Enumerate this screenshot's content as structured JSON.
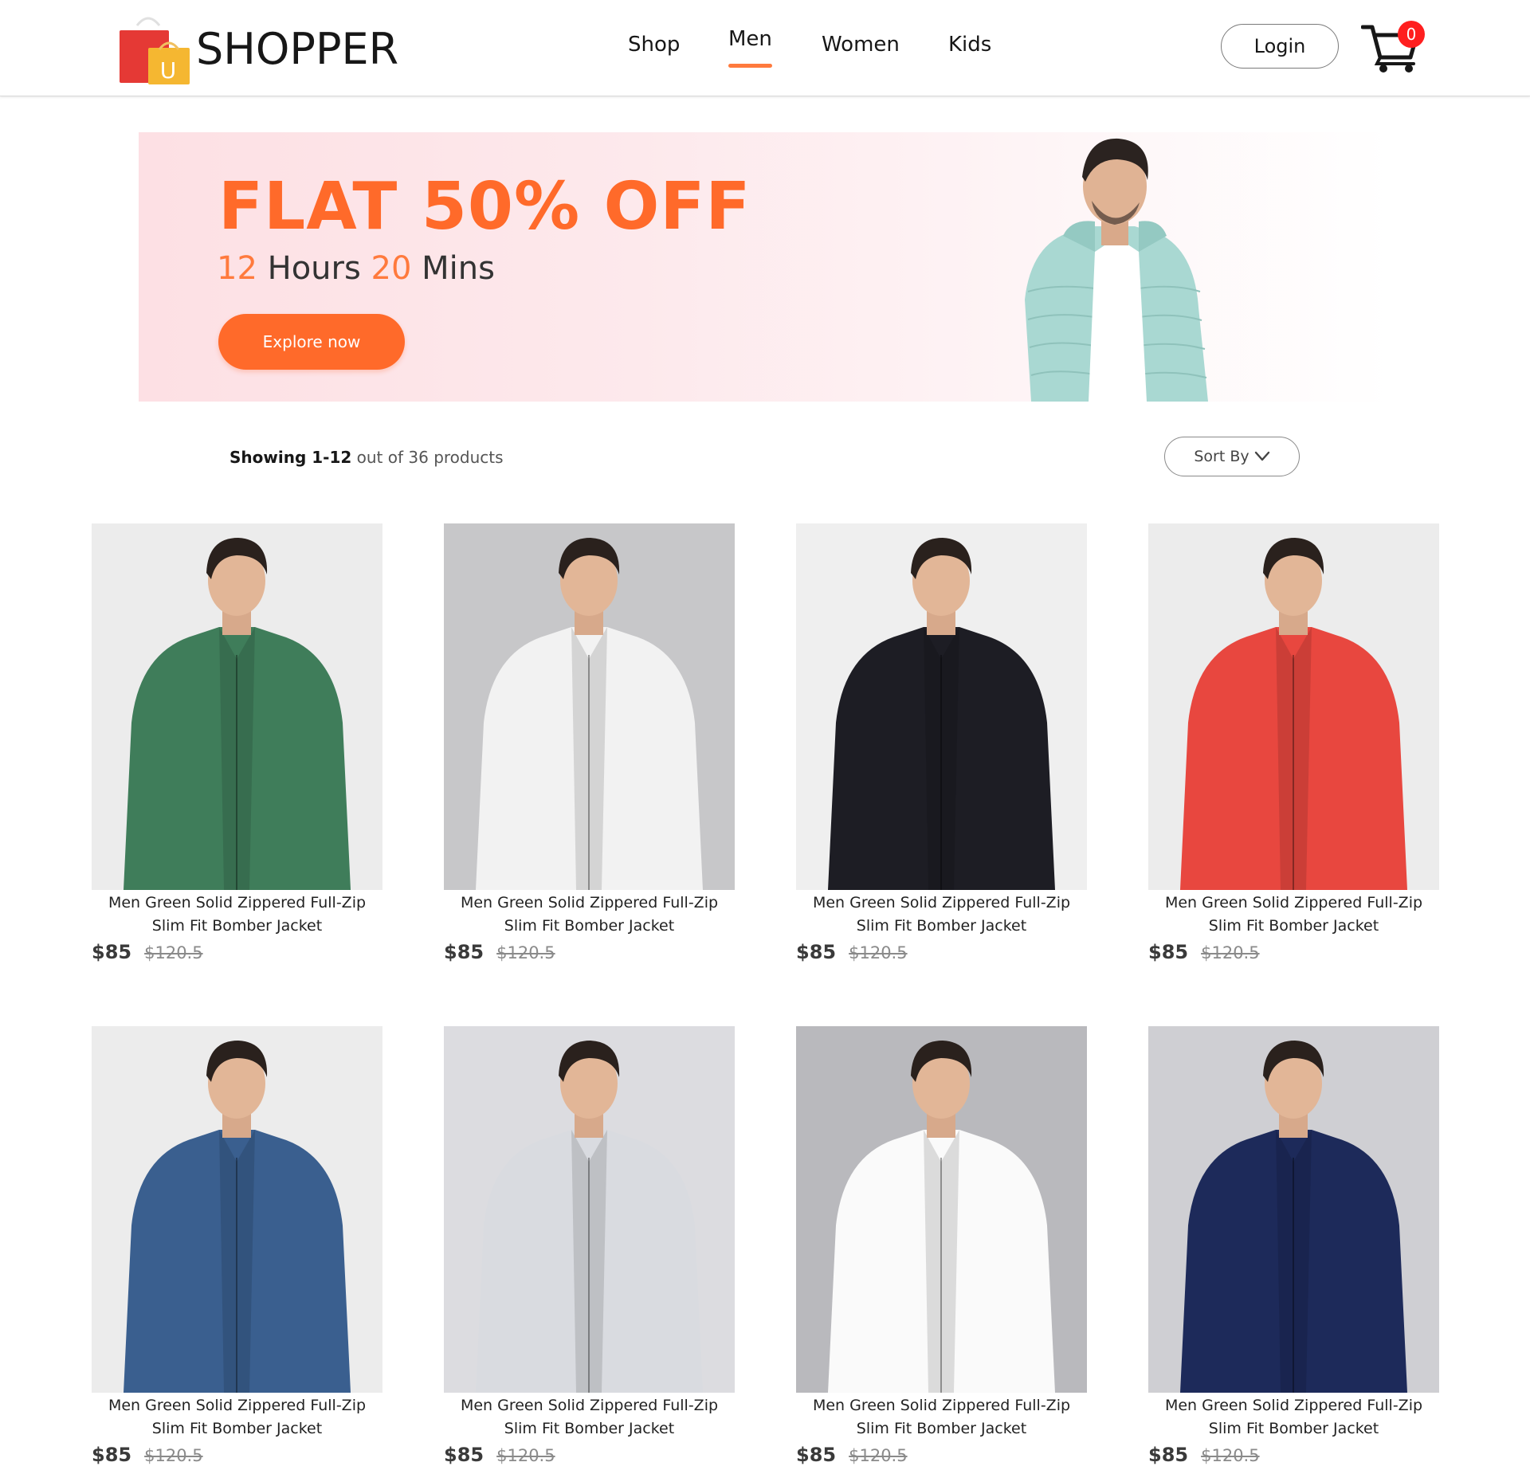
{
  "brand": {
    "name": "SHOPPER",
    "logo_letter": "U",
    "colors": {
      "bag_red": "#e53935",
      "bag_yellow": "#f5b731"
    }
  },
  "nav": {
    "items": [
      {
        "label": "Shop",
        "active": false
      },
      {
        "label": "Men",
        "active": true
      },
      {
        "label": "Women",
        "active": false
      },
      {
        "label": "Kids",
        "active": false
      }
    ],
    "active_color": "#ff7a3d"
  },
  "header": {
    "login_label": "Login",
    "cart_icon": "cart-icon",
    "cart_count": "0",
    "badge_color": "#ff1f1f"
  },
  "hero": {
    "title": "FLAT 50% OFF",
    "hours": "12",
    "hours_label": "Hours",
    "mins": "20",
    "mins_label": "Mins",
    "button_label": "Explore now",
    "accent_color": "#ff6a2a"
  },
  "results": {
    "range_prefix": "Showing 1-12",
    "range_suffix": "out of 36 products",
    "sort_label": "Sort By",
    "sort_icon": "chevron-down-icon"
  },
  "products": [
    {
      "name": "Men Green Solid Zippered Full-Zip Slim Fit Bomber Jacket",
      "price": "$85",
      "old_price": "$120.5",
      "jacket": "#3f7d5a",
      "bg": "#ececec"
    },
    {
      "name": "Men Green Solid Zippered Full-Zip Slim Fit Bomber Jacket",
      "price": "$85",
      "old_price": "$120.5",
      "jacket": "#f2f2f2",
      "bg": "#c7c7c9"
    },
    {
      "name": "Men Green Solid Zippered Full-Zip Slim Fit Bomber Jacket",
      "price": "$85",
      "old_price": "$120.5",
      "jacket": "#1d1d24",
      "bg": "#efefef"
    },
    {
      "name": "Men Green Solid Zippered Full-Zip Slim Fit Bomber Jacket",
      "price": "$85",
      "old_price": "$120.5",
      "jacket": "#e8473f",
      "bg": "#ececec"
    },
    {
      "name": "Men Green Solid Zippered Full-Zip Slim Fit Bomber Jacket",
      "price": "$85",
      "old_price": "$120.5",
      "jacket": "#3a5f8f",
      "bg": "#ececec"
    },
    {
      "name": "Men Green Solid Zippered Full-Zip Slim Fit Bomber Jacket",
      "price": "$85",
      "old_price": "$120.5",
      "jacket": "#d9dbe0",
      "bg": "#dcdce0"
    },
    {
      "name": "Men Green Solid Zippered Full-Zip Slim Fit Bomber Jacket",
      "price": "$85",
      "old_price": "$120.5",
      "jacket": "#fafafa",
      "bg": "#b9b9bd"
    },
    {
      "name": "Men Green Solid Zippered Full-Zip Slim Fit Bomber Jacket",
      "price": "$85",
      "old_price": "$120.5",
      "jacket": "#1d2a5a",
      "bg": "#cfcfd3"
    }
  ]
}
